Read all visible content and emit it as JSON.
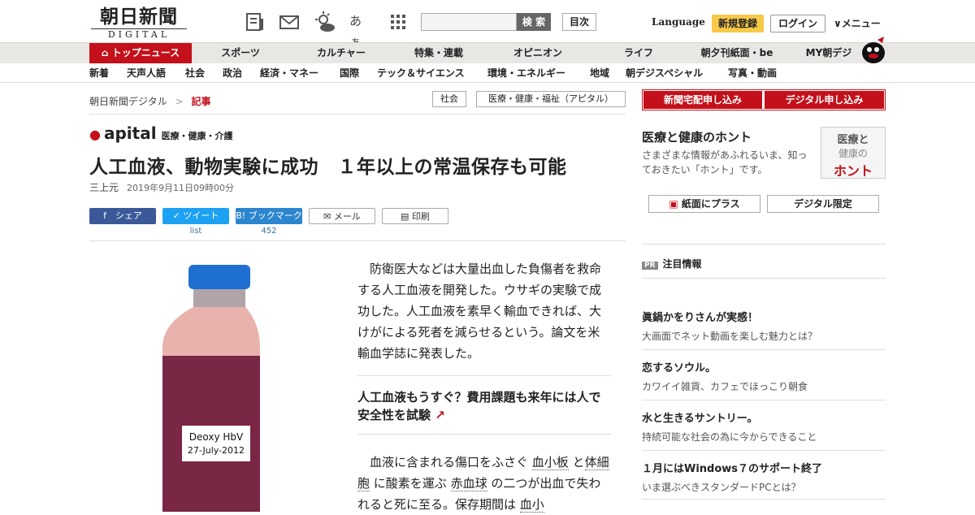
{
  "header": {
    "logo_jp": "朝日新聞",
    "logo_en": "DIGITAL",
    "icons": [
      "newspaper-icon",
      "mail-icon",
      "weather-icon",
      "font-size-icon",
      "apps-grid-icon"
    ],
    "font_icon_text": "あぁ",
    "search_button": "検 索",
    "toc_button": "目次",
    "language": "Language",
    "register": "新規登録",
    "login": "ログイン",
    "menu": "∨メニュー"
  },
  "nav_primary": [
    "トップニュース",
    "スポーツ",
    "カルチャー",
    "特集・連載",
    "オピニオン",
    "ライフ",
    "朝夕刊紙面・be",
    "MY朝デジ"
  ],
  "nav_secondary": [
    "新着",
    "天声人語",
    "社会",
    "政治",
    "経済・マネー",
    "国際",
    "テック＆サイエンス",
    "環境・エネルギー",
    "地域",
    "朝デジスペシャル",
    "写真・動画"
  ],
  "breadcrumb": {
    "home": "朝日新聞デジタル",
    "sep": ">",
    "current": "記事"
  },
  "tags": [
    "社会",
    "医療・健康・福祉（アピタル）"
  ],
  "article": {
    "brand": "apital",
    "brand_sub": "医療・健康・介護",
    "title": "人工血液、動物実験に成功　１年以上の常温保存も可能",
    "author": "三上元",
    "date": "2019年9月11日09時00分",
    "share": {
      "facebook": "シェア",
      "twitter": "ツイート",
      "hatena": "ブックマーク",
      "mail": "メール",
      "print": "印刷",
      "twitter_count": "list",
      "hatena_count": "452"
    },
    "photo_label1": "Deoxy HbV",
    "photo_label2": "27-July-2012",
    "lead": "　防衛医大などは大量出血した負傷者を救命する人工血液を開発した。ウサギの実験で成功した。人工血液を素早く輸血できれば、大けがによる死者を減らせるという。論文を米輸血学誌に発表した。",
    "related": "人工血液もうすぐ？費用課題も来年には人で安全性を試験",
    "body2_a": "　血液に含まれる傷口をふさぐ ",
    "body2_w1": "血小板",
    "body2_b": " と",
    "body2_w2": "体細胞",
    "body2_c": " に酸素を運ぶ ",
    "body2_w3": "赤血球",
    "body2_d": " の二つが出血で失われると死に至る。保存期間は ",
    "body2_w4": "血小"
  },
  "right": {
    "btn_delivery": "新聞宅配申し込み",
    "btn_digital": "デジタル申し込み",
    "honto_title": "医療と健康のホント",
    "honto_desc": "さまざまな情報があふれるいま、知っておきたい「ホント」です。",
    "honto_img1": "医療と",
    "honto_img2": "健康の",
    "honto_img3": "ホント",
    "btn_plus": "紙面にプラス",
    "btn_limited": "デジタル限定",
    "pr_badge": "PR",
    "pr_title": "注目情報",
    "ads": [
      {
        "h": "眞鍋かをりさんが実感！",
        "s": "大画面でネット動画を楽しむ魅力とは？"
      },
      {
        "h": "恋するソウル。",
        "s": "カワイイ雑貨、カフェでほっこり朝食"
      },
      {
        "h": "水と生きるサントリー。",
        "s": "持続可能な社会の為に今からできること"
      },
      {
        "h": "１月にはWindows７のサポート終了",
        "s": "いま選ぶべきスタンダードPCとは？"
      }
    ]
  },
  "colors": {
    "brand_red": "#c4101a",
    "register_yellow": "#f7c948",
    "twitter": "#1da1f2",
    "facebook": "#3b5998",
    "hatena": "#2c86cf"
  }
}
